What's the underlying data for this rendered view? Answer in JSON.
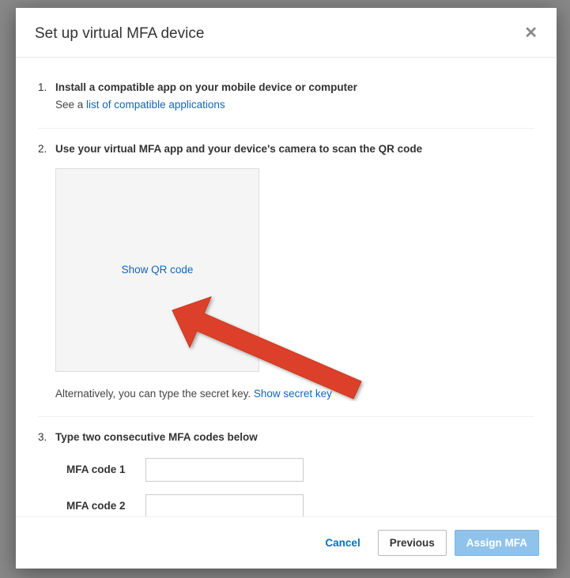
{
  "dialog": {
    "title": "Set up virtual MFA device"
  },
  "steps": {
    "s1": {
      "num": "1.",
      "title": "Install a compatible app on your mobile device or computer",
      "subtext_prefix": "See a ",
      "link": "list of compatible applications"
    },
    "s2": {
      "num": "2.",
      "title": "Use your virtual MFA app and your device's camera to scan the QR code",
      "show_qr": "Show QR code",
      "alt_prefix": "Alternatively, you can type the secret key. ",
      "alt_link": "Show secret key"
    },
    "s3": {
      "num": "3.",
      "title": "Type two consecutive MFA codes below",
      "code1_label": "MFA code 1",
      "code2_label": "MFA code 2"
    }
  },
  "footer": {
    "cancel": "Cancel",
    "previous": "Previous",
    "assign": "Assign MFA"
  }
}
